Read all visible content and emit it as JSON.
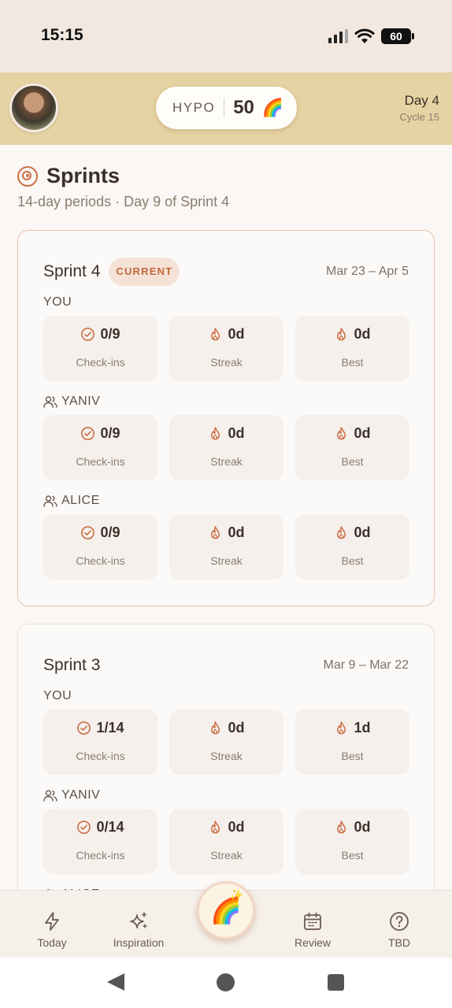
{
  "status_bar": {
    "time": "15:15",
    "battery": "60"
  },
  "header": {
    "hypo_label": "HYPO",
    "hypo_count": "50",
    "hypo_emoji": "🌈",
    "day": "Day 4",
    "cycle": "Cycle 15"
  },
  "page": {
    "title": "Sprints",
    "subtitle": "14-day periods · Day 9 of Sprint 4"
  },
  "sprints": [
    {
      "name": "Sprint 4",
      "badge": "CURRENT",
      "dates": "Mar 23 – Apr 5",
      "members": [
        {
          "label": "YOU",
          "icon": "none",
          "stats": [
            {
              "icon": "check-circle-icon",
              "value": "0/9",
              "label": "Check-ins"
            },
            {
              "icon": "flame-icon",
              "value": "0d",
              "label": "Streak"
            },
            {
              "icon": "flame-icon",
              "value": "0d",
              "label": "Best"
            }
          ]
        },
        {
          "label": "YANIV",
          "icon": "people-icon",
          "stats": [
            {
              "icon": "check-circle-icon",
              "value": "0/9",
              "label": "Check-ins"
            },
            {
              "icon": "flame-icon",
              "value": "0d",
              "label": "Streak"
            },
            {
              "icon": "flame-icon",
              "value": "0d",
              "label": "Best"
            }
          ]
        },
        {
          "label": "ALICE",
          "icon": "people-icon",
          "stats": [
            {
              "icon": "check-circle-icon",
              "value": "0/9",
              "label": "Check-ins"
            },
            {
              "icon": "flame-icon",
              "value": "0d",
              "label": "Streak"
            },
            {
              "icon": "flame-icon",
              "value": "0d",
              "label": "Best"
            }
          ]
        }
      ]
    },
    {
      "name": "Sprint 3",
      "badge": "",
      "dates": "Mar 9 – Mar 22",
      "members": [
        {
          "label": "YOU",
          "icon": "none",
          "stats": [
            {
              "icon": "check-circle-icon",
              "value": "1/14",
              "label": "Check-ins"
            },
            {
              "icon": "flame-icon",
              "value": "0d",
              "label": "Streak"
            },
            {
              "icon": "flame-icon",
              "value": "1d",
              "label": "Best"
            }
          ]
        },
        {
          "label": "YANIV",
          "icon": "people-icon",
          "stats": [
            {
              "icon": "check-circle-icon",
              "value": "0/14",
              "label": "Check-ins"
            },
            {
              "icon": "flame-icon",
              "value": "0d",
              "label": "Streak"
            },
            {
              "icon": "flame-icon",
              "value": "0d",
              "label": "Best"
            }
          ]
        },
        {
          "label": "ALICE",
          "icon": "people-icon",
          "stats": []
        }
      ]
    }
  ],
  "bottom_nav": {
    "items": [
      {
        "label": "Today",
        "icon": "bolt-icon"
      },
      {
        "label": "Inspiration",
        "icon": "sparkles-icon"
      },
      {
        "label": "Review",
        "icon": "calendar-icon"
      },
      {
        "label": "TBD",
        "icon": "help-circle-icon"
      }
    ],
    "center_emoji": "🌈",
    "center_sparkle": "✨"
  },
  "colors": {
    "accent": "#cc6f45",
    "header_bg": "#e6d3a3",
    "status_bg": "#f3e8df",
    "badge_bg": "#f5e2d6",
    "badge_text": "#c2683c",
    "stat_bg": "#f5f0ec"
  }
}
